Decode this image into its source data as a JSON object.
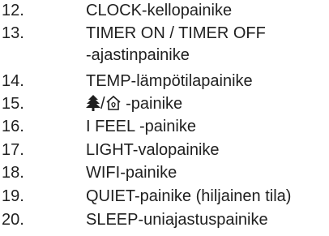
{
  "list": [
    {
      "number": "12.",
      "text": "CLOCK-kellopainike"
    },
    {
      "number": "13.",
      "text": "TIMER ON / TIMER OFF"
    },
    {
      "number": "",
      "text": "-ajastinpainike"
    },
    {
      "number": "14.",
      "text": "TEMP-lämpötilapainike"
    },
    {
      "number": "15.",
      "icon_left": "tree-icon",
      "separator": "/",
      "icon_right": "house-icon",
      "text": " -painike"
    },
    {
      "number": "16.",
      "text": "I FEEL -painike"
    },
    {
      "number": "17.",
      "text": "LIGHT-valopainike"
    },
    {
      "number": "18.",
      "text": "WIFI-painike"
    },
    {
      "number": "19.",
      "text": "QUIET-painike (hiljainen tila)"
    },
    {
      "number": "20.",
      "text": "SLEEP-uniajastuspainike"
    }
  ]
}
